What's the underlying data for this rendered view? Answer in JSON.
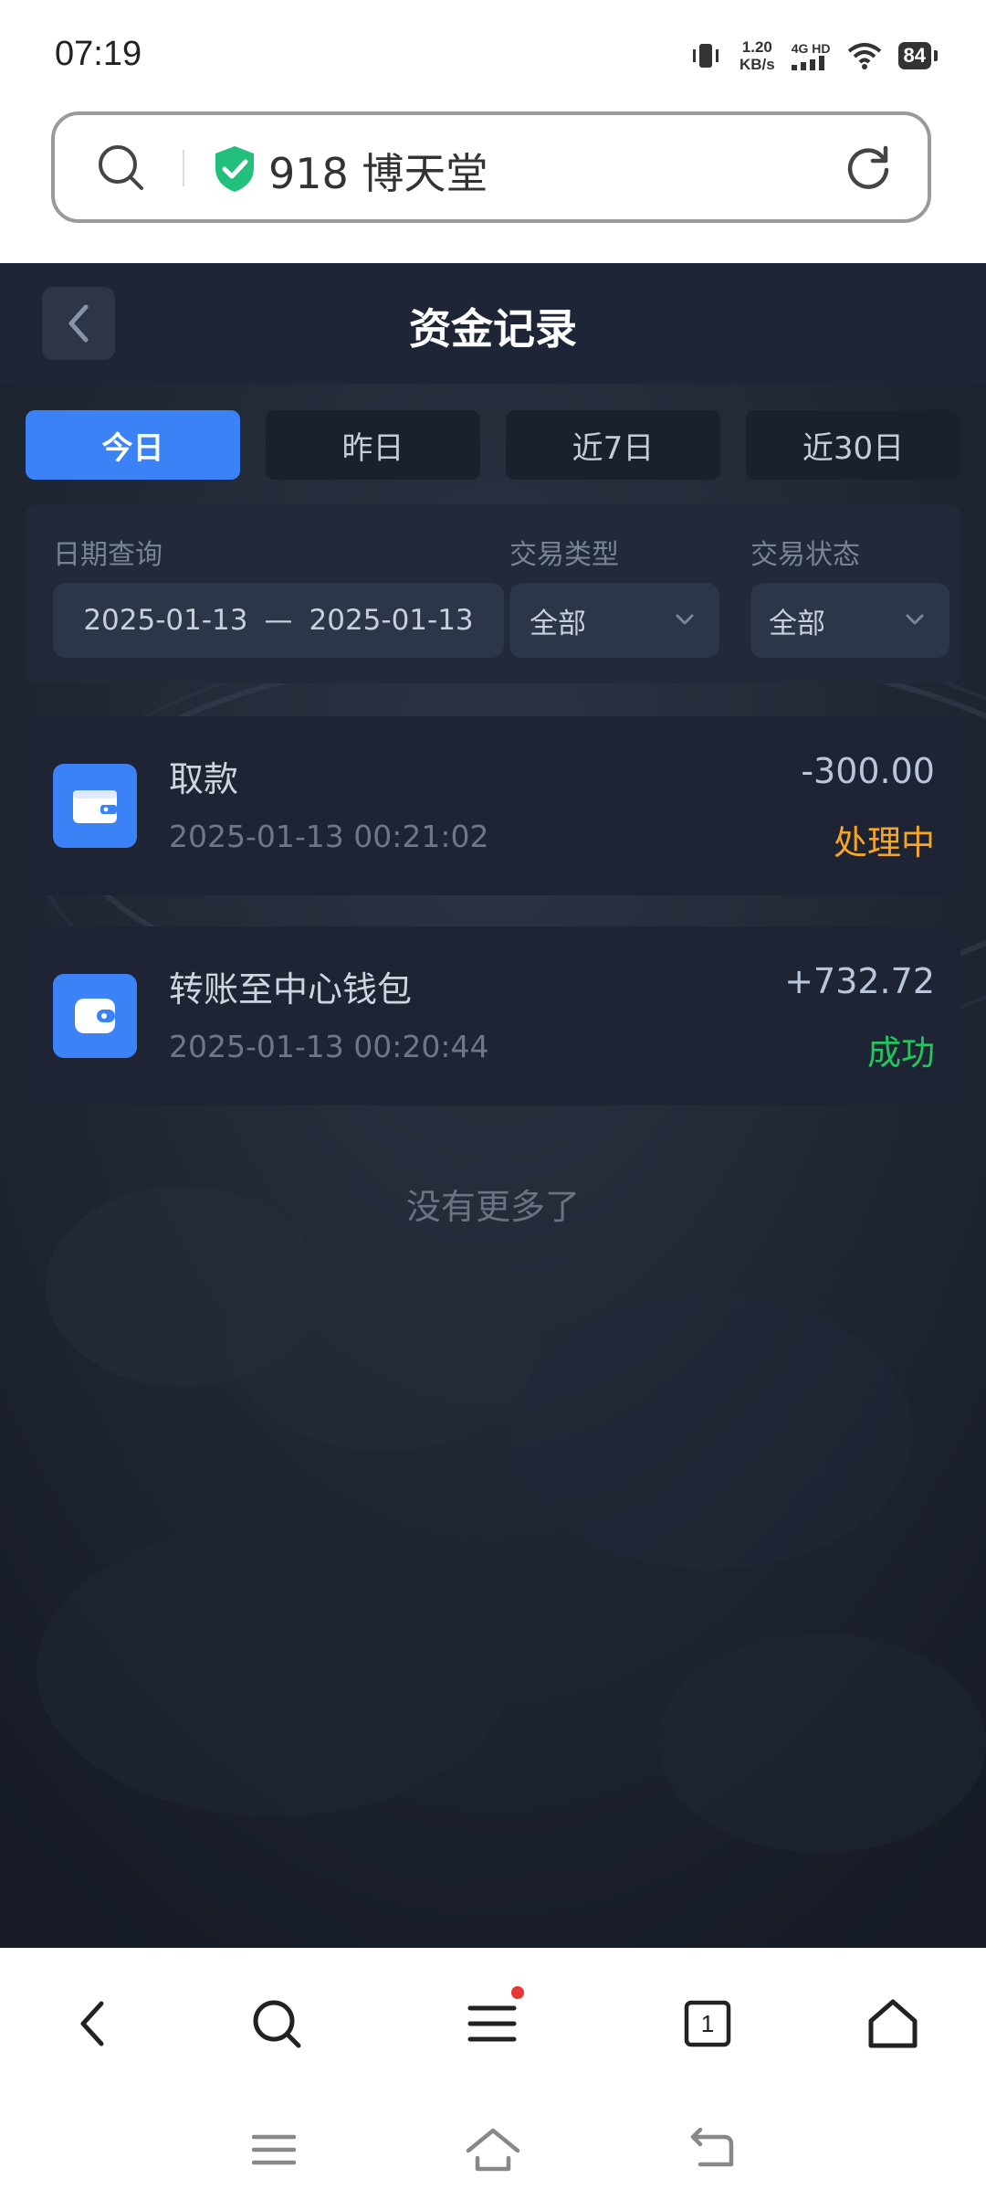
{
  "status_bar": {
    "time": "07:19",
    "net_speed_value": "1.20",
    "net_speed_unit": "KB/s",
    "signal_label": "4G HD",
    "battery": "84"
  },
  "address_bar": {
    "site_name": "918 博天堂"
  },
  "header": {
    "title": "资金记录"
  },
  "tabs": [
    {
      "label": "今日",
      "active": true
    },
    {
      "label": "昨日",
      "active": false
    },
    {
      "label": "近7日",
      "active": false
    },
    {
      "label": "近30日",
      "active": false
    }
  ],
  "filters": {
    "date_label": "日期查询",
    "date_start": "2025-01-13",
    "date_sep": "—",
    "date_end": "2025-01-13",
    "type_label": "交易类型",
    "type_value": "全部",
    "status_label": "交易状态",
    "status_value": "全部"
  },
  "records": [
    {
      "name": "取款",
      "time": "2025-01-13 00:21:02",
      "amount": "-300.00",
      "status": "处理中",
      "status_color": "#f5a623",
      "icon": "wallet-icon"
    },
    {
      "name": "转账至中心钱包",
      "time": "2025-01-13 00:20:44",
      "amount": "+732.72",
      "status": "成功",
      "status_color": "#22c55e",
      "icon": "wallet-transfer-icon"
    }
  ],
  "list_end_text": "没有更多了",
  "browser_nav": {
    "tabs_count": "1"
  },
  "colors": {
    "accent": "#3b82f6",
    "background": "#1c2231"
  }
}
